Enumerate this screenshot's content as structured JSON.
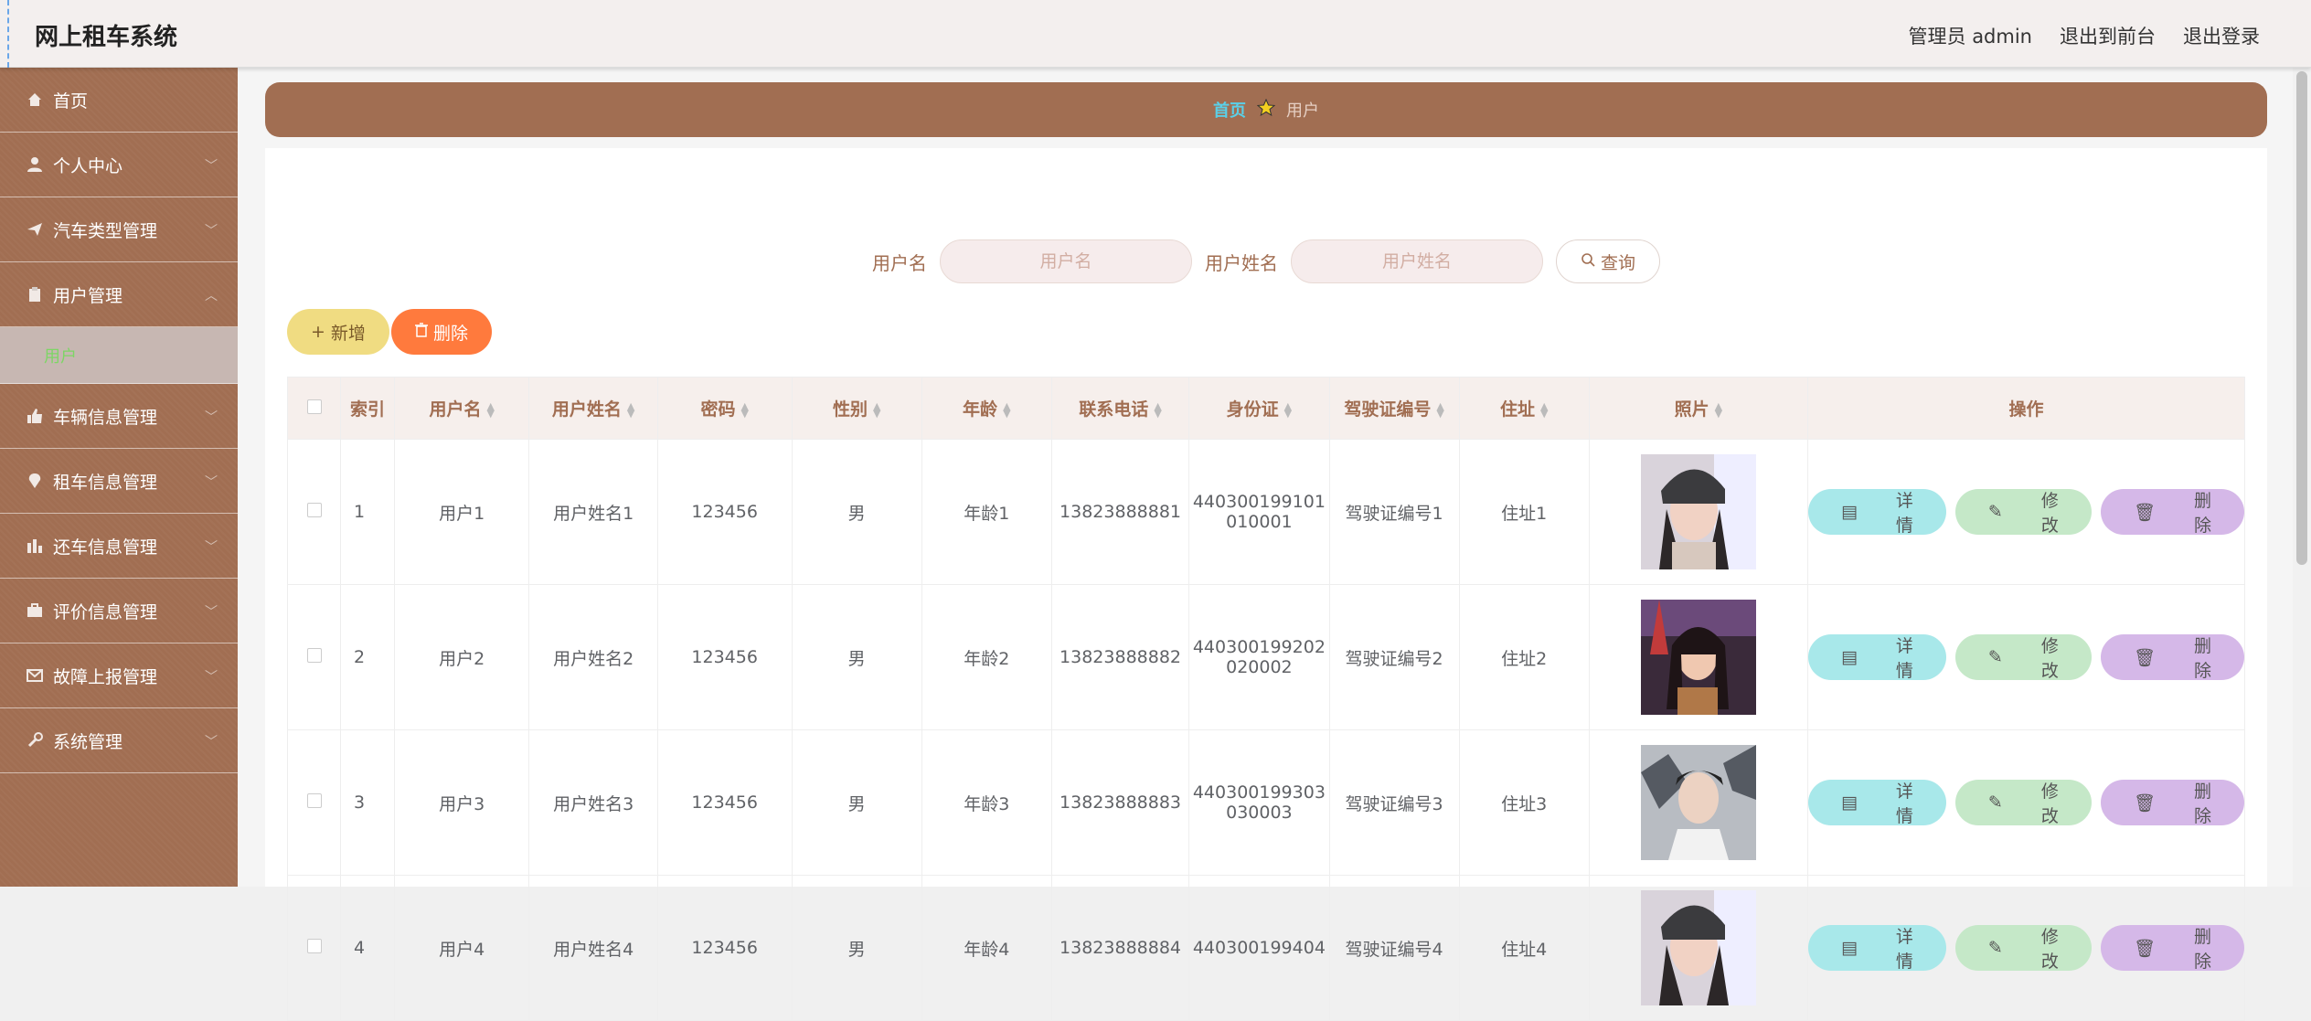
{
  "app_title": "网上租车系统",
  "top_links": [
    "管理员 admin",
    "退出到前台",
    "退出登录"
  ],
  "sidebar": {
    "items": [
      {
        "label": "首页",
        "icon": "home-icon",
        "expandable": false
      },
      {
        "label": "个人中心",
        "icon": "user-icon",
        "expandable": true
      },
      {
        "label": "汽车类型管理",
        "icon": "send-icon",
        "expandable": true
      },
      {
        "label": "用户管理",
        "icon": "clipboard-icon",
        "expandable": true,
        "open": true
      },
      {
        "label": "车辆信息管理",
        "icon": "thumb-icon",
        "expandable": true
      },
      {
        "label": "租车信息管理",
        "icon": "location-icon",
        "expandable": true
      },
      {
        "label": "还车信息管理",
        "icon": "chart-icon",
        "expandable": true
      },
      {
        "label": "评价信息管理",
        "icon": "briefcase-icon",
        "expandable": true
      },
      {
        "label": "故障上报管理",
        "icon": "mail-icon",
        "expandable": true
      },
      {
        "label": "系统管理",
        "icon": "tool-icon",
        "expandable": true
      }
    ],
    "sub_item": "用户"
  },
  "breadcrumb": {
    "home": "首页",
    "current": "用户"
  },
  "search": {
    "field1_label": "用户名",
    "field1_placeholder": "用户名",
    "field2_label": "用户姓名",
    "field2_placeholder": "用户姓名",
    "query_label": "查询"
  },
  "actions": {
    "add_label": "新增",
    "delete_label": "删除"
  },
  "table": {
    "headers": [
      "索引",
      "用户名",
      "用户姓名",
      "密码",
      "性别",
      "年龄",
      "联系电话",
      "身份证",
      "驾驶证编号",
      "住址",
      "照片",
      "操作"
    ],
    "rows": [
      {
        "index": "1",
        "username": "用户1",
        "name": "用户姓名1",
        "password": "123456",
        "gender": "男",
        "age": "年龄1",
        "phone": "13823888881",
        "id_line1": "440300199101",
        "id_line2": "010001",
        "license": "驾驶证编号1",
        "address": "住址1"
      },
      {
        "index": "2",
        "username": "用户2",
        "name": "用户姓名2",
        "password": "123456",
        "gender": "男",
        "age": "年龄2",
        "phone": "13823888882",
        "id_line1": "440300199202",
        "id_line2": "020002",
        "license": "驾驶证编号2",
        "address": "住址2"
      },
      {
        "index": "3",
        "username": "用户3",
        "name": "用户姓名3",
        "password": "123456",
        "gender": "男",
        "age": "年龄3",
        "phone": "13823888883",
        "id_line1": "440300199303",
        "id_line2": "030003",
        "license": "驾驶证编号3",
        "address": "住址3"
      },
      {
        "index": "4",
        "username": "用户4",
        "name": "用户姓名4",
        "password": "123456",
        "gender": "男",
        "age": "年龄4",
        "phone": "13823888884",
        "id_line1": "440300199404",
        "id_line2": "",
        "license": "驾驶证编号4",
        "address": "住址4"
      }
    ],
    "ops": {
      "detail": "详情",
      "edit": "修改",
      "delete": "删除"
    }
  },
  "colors": {
    "brand": "#a16e52",
    "add_button": "#f0dc82",
    "delete_button": "#ff7a3d",
    "detail_button": "#a8e8ea",
    "edit_button": "#c5e8c8",
    "row_delete_button": "#d5b8e8"
  }
}
